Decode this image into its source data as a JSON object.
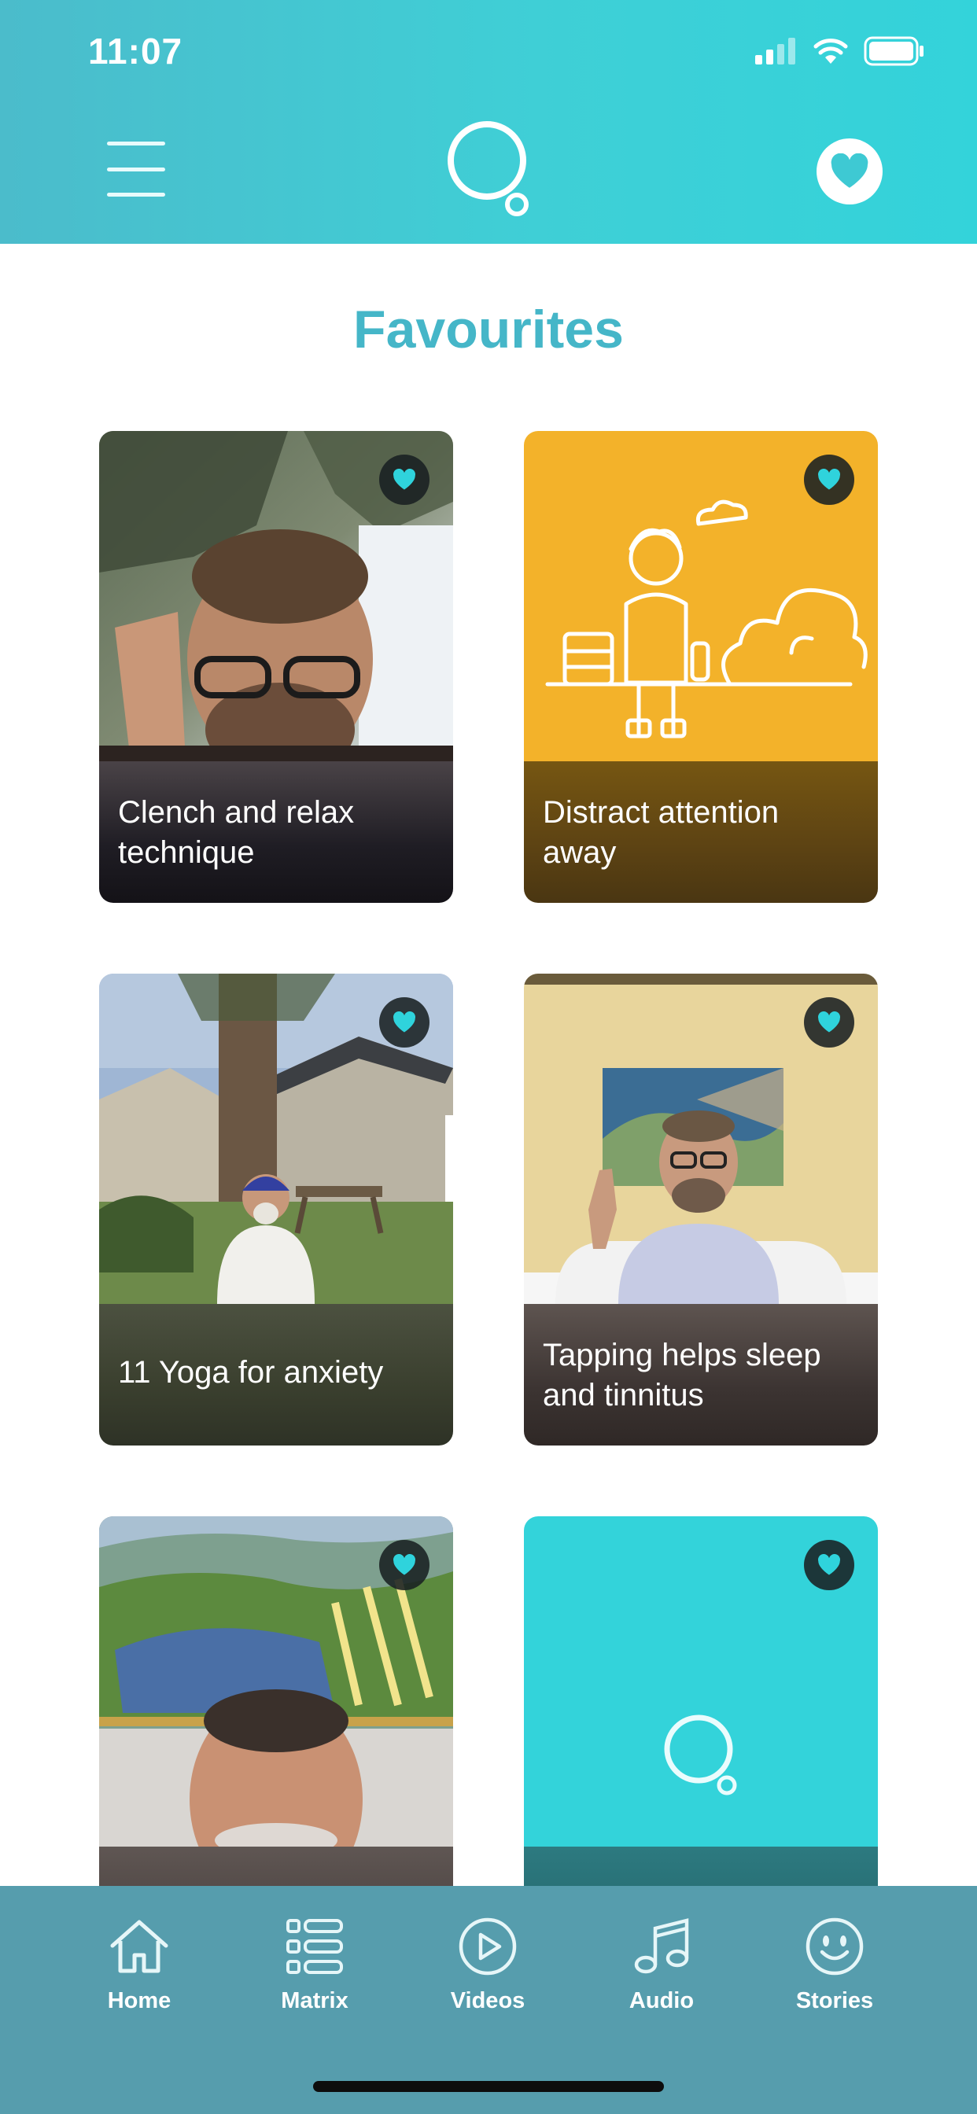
{
  "status_bar": {
    "time": "11:07"
  },
  "page": {
    "title": "Favourites"
  },
  "cards": [
    {
      "title": "Clench and relax technique"
    },
    {
      "title": "Distract attention away"
    },
    {
      "title": "11 Yoga for anxiety"
    },
    {
      "title": "Tapping helps sleep and tinnitus"
    },
    {
      "title": ""
    },
    {
      "title": ""
    }
  ],
  "nav": [
    {
      "label": "Home",
      "icon": "home-icon"
    },
    {
      "label": "Matrix",
      "icon": "list-icon"
    },
    {
      "label": "Videos",
      "icon": "play-icon"
    },
    {
      "label": "Audio",
      "icon": "music-icon"
    },
    {
      "label": "Stories",
      "icon": "smiley-icon"
    }
  ],
  "colors": {
    "header": "#3fcfd6",
    "title": "#45b6c8",
    "nav": "#569dad",
    "heart_accent": "#2fd3dc",
    "card_yellow": "#f3b22a"
  }
}
